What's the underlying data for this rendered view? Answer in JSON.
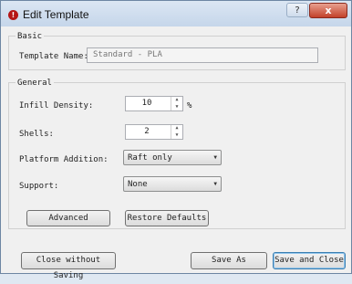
{
  "window": {
    "title": "Edit Template",
    "help_glyph": "?",
    "close_glyph": "x"
  },
  "basic": {
    "section": "Basic",
    "template_name_label": "Template Name:",
    "template_name_value": "Standard - PLA"
  },
  "general": {
    "section": "General",
    "infill_label": "Infill Density:",
    "infill_value": "10",
    "infill_unit": "%",
    "shells_label": "Shells:",
    "shells_value": "2",
    "platform_label": "Platform Addition:",
    "platform_value": "Raft only",
    "support_label": "Support:",
    "support_value": "None",
    "advanced_label": "Advanced",
    "restore_label": "Restore Defaults"
  },
  "footer": {
    "close_without_saving": "Close without Saving",
    "save_as": "Save As",
    "save_and_close": "Save and Close"
  }
}
